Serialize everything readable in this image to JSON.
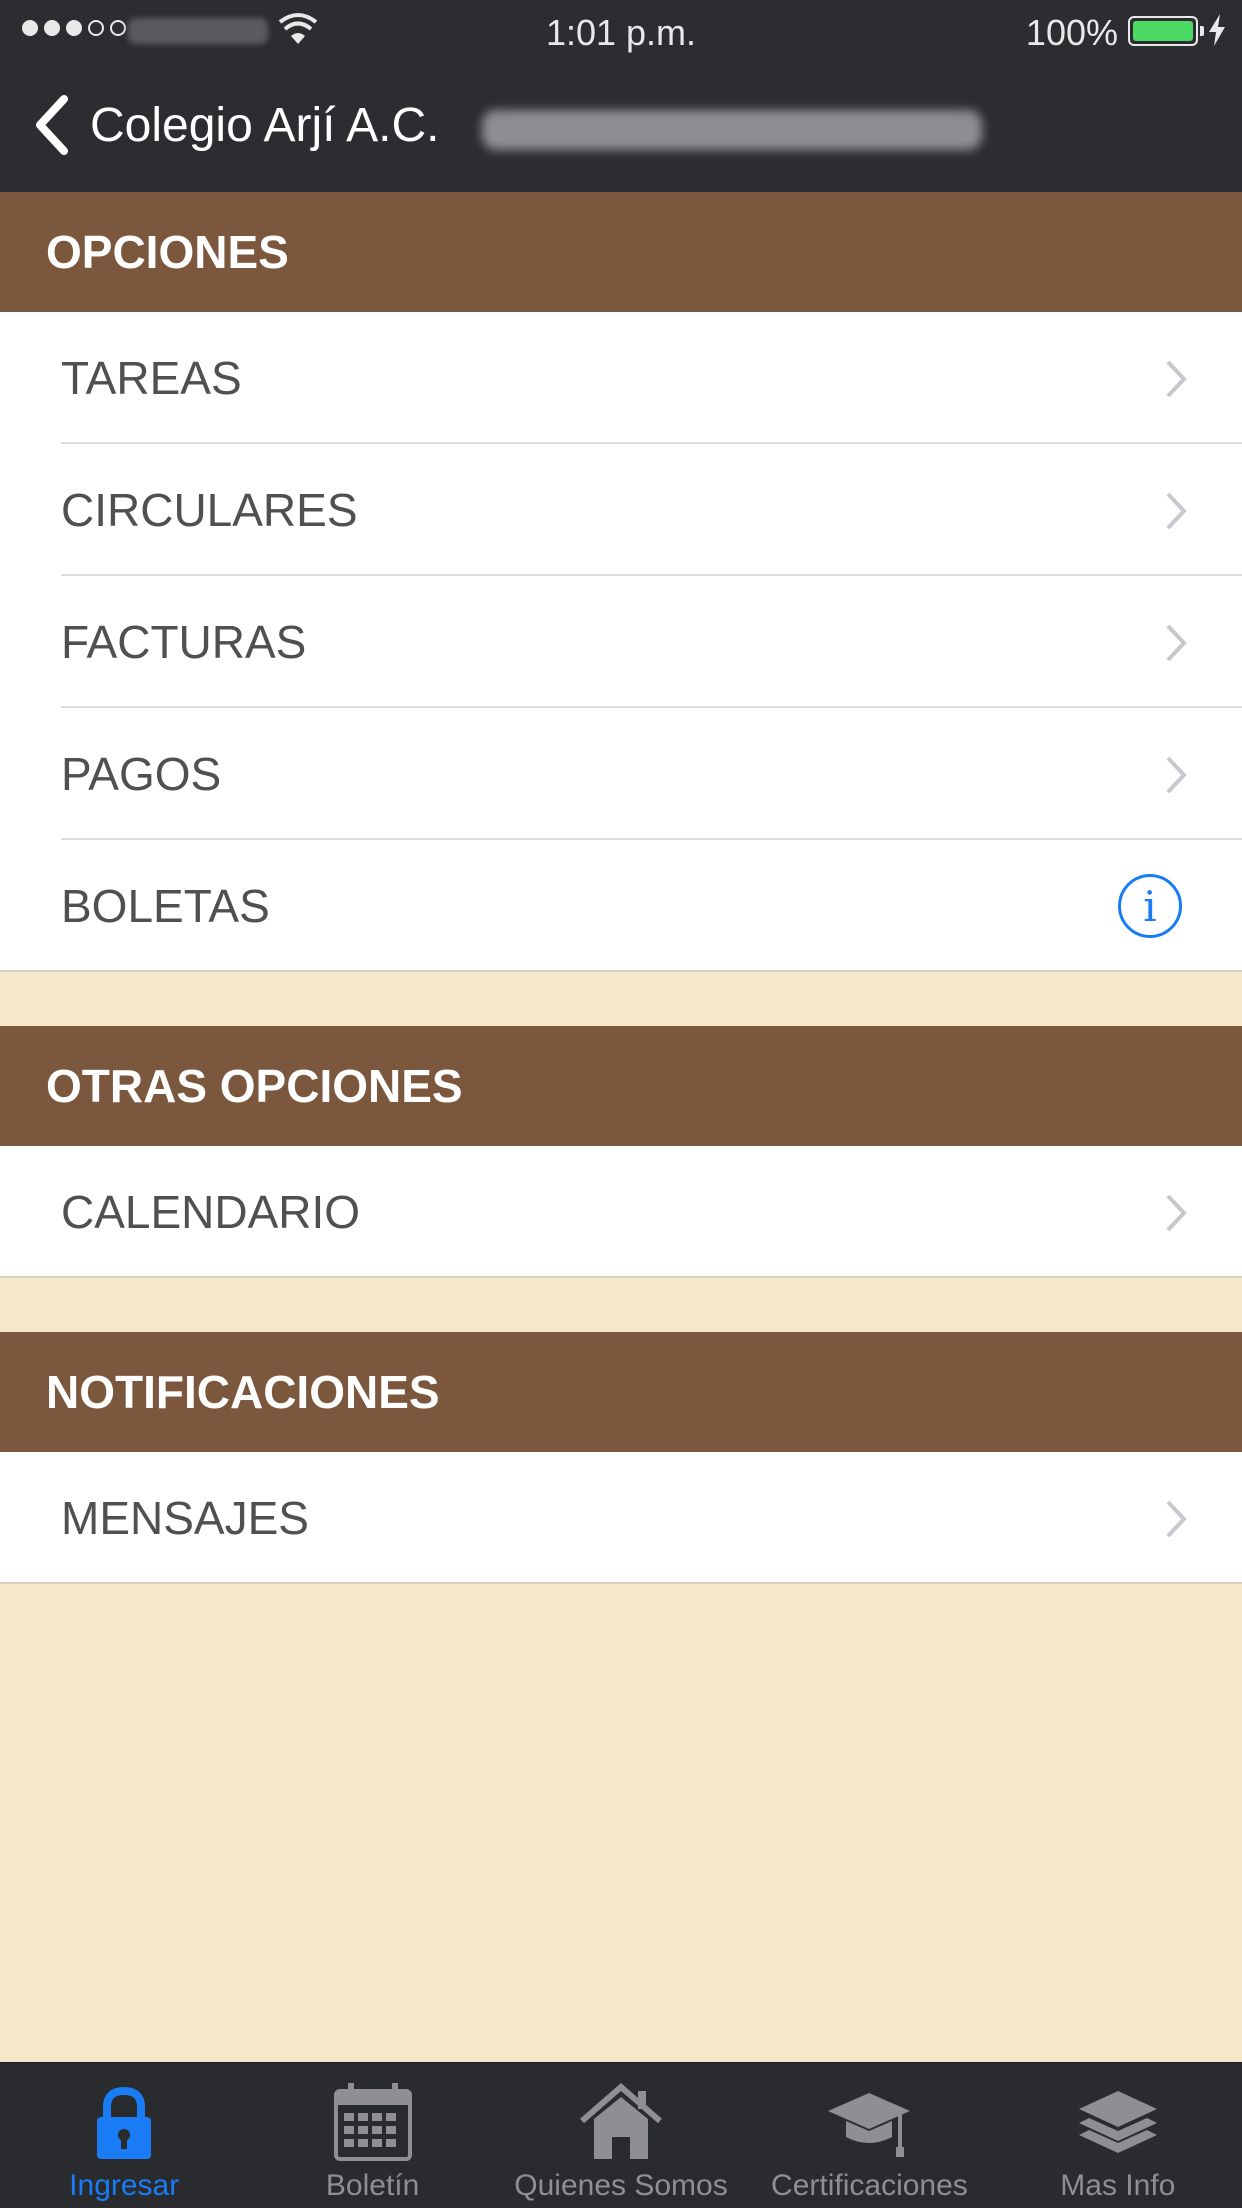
{
  "status_bar": {
    "time": "1:01 p.m.",
    "battery": "100%",
    "battery_level": 1.0,
    "battery_color": "#4cd964"
  },
  "nav": {
    "back_icon": "chevron-left-icon",
    "title": "Colegio Arjí A.C."
  },
  "sections": {
    "opciones": {
      "title": "OPCIONES",
      "items": [
        {
          "label": "TAREAS",
          "accessory": "chevron-right-icon"
        },
        {
          "label": "CIRCULARES",
          "accessory": "chevron-right-icon"
        },
        {
          "label": "FACTURAS",
          "accessory": "chevron-right-icon"
        },
        {
          "label": "PAGOS",
          "accessory": "chevron-right-icon"
        },
        {
          "label": "BOLETAS",
          "accessory": "info-icon",
          "accessory_text": "i"
        }
      ]
    },
    "otras_opciones": {
      "title": "OTRAS OPCIONES",
      "items": [
        {
          "label": "CALENDARIO",
          "accessory": "chevron-right-icon"
        }
      ]
    },
    "notificaciones": {
      "title": "NOTIFICACIONES",
      "items": [
        {
          "label": "MENSAJES",
          "accessory": "chevron-right-icon"
        }
      ]
    }
  },
  "tab_bar": {
    "tabs": [
      {
        "label": "Ingresar",
        "icon": "lock-icon",
        "active": true
      },
      {
        "label": "Boletín",
        "icon": "calendar-icon",
        "active": false
      },
      {
        "label": "Quienes Somos",
        "icon": "house-icon",
        "active": false
      },
      {
        "label": "Certificaciones",
        "icon": "graduation-cap-icon",
        "active": false
      },
      {
        "label": "Mas Info",
        "icon": "layers-icon",
        "active": false
      }
    ]
  },
  "colors": {
    "bar_background": "#2c2d30",
    "section_header": "#7b573d",
    "page_background": "#f4e8c9",
    "accent": "#1a7cf5"
  }
}
